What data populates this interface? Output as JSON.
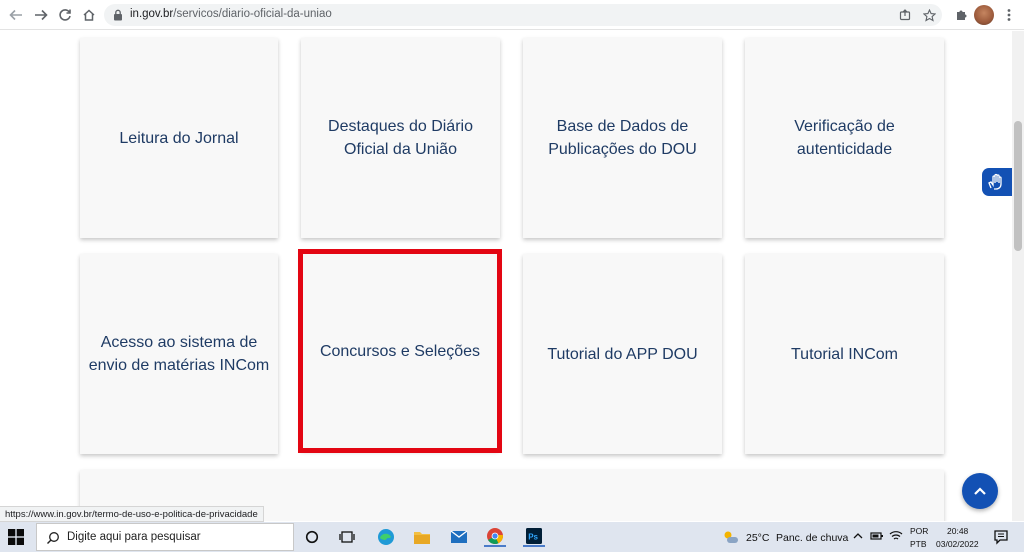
{
  "browser": {
    "url_host": "in.gov.br",
    "url_path": "/servicos/diario-oficial-da-uniao"
  },
  "cards": [
    {
      "label": "Leitura do Jornal"
    },
    {
      "label": "Destaques do Diário Oficial da União"
    },
    {
      "label": "Base de Dados de Publicações do DOU"
    },
    {
      "label": "Verificação de autenticidade"
    },
    {
      "label": "Acesso ao sistema de envio de matérias INCom"
    },
    {
      "label": "Concursos e Seleções"
    },
    {
      "label": "Tutorial do APP DOU"
    },
    {
      "label": "Tutorial INCom"
    }
  ],
  "status_bar": {
    "link_url": "https://www.in.gov.br/termo-de-uso-e-politica-de-privacidade"
  },
  "taskbar": {
    "search_placeholder": "Digite aqui para pesquisar",
    "weather_temp": "25°C",
    "weather_desc": "Panc. de chuva",
    "lang_1": "POR",
    "lang_2": "PTB",
    "time": "20:48",
    "date": "03/02/2022"
  },
  "colors": {
    "accent_blue": "#1351b4",
    "highlight_red": "#e30613",
    "card_text": "#1f3b64"
  }
}
